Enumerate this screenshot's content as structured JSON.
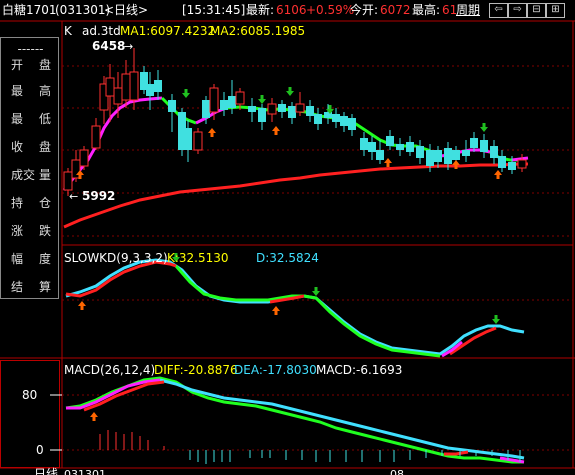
{
  "title_bar": {
    "instrument": "白糖1701",
    "code": "(031301)",
    "period": "<日线>",
    "time": "[15:31:45]",
    "latest_label": "最新:",
    "latest_value": "6106",
    "change_pct": "+0.59%",
    "open_label": "今开:",
    "open_value": "6072",
    "high_label": "最高:",
    "high_value": "61",
    "period_button": "周期",
    "nav_icons": [
      "arrow-left-icon",
      "arrow-right-icon",
      "zoom-out-icon",
      "zoom-in-icon"
    ],
    "nav_glyphs": [
      "⇦",
      "⇨",
      "⊟",
      "⊞"
    ]
  },
  "side_panel": {
    "dash": "------",
    "items": [
      {
        "a": "开",
        "b": "盘"
      },
      {
        "a": "最",
        "b": "高"
      },
      {
        "a": "最",
        "b": "低"
      },
      {
        "a": "收",
        "b": "盘"
      },
      {
        "a": "成交",
        "b": "量"
      },
      {
        "a": "持",
        "b": "仓"
      },
      {
        "a": "涨",
        "b": "跌"
      },
      {
        "a": "幅",
        "b": "度"
      },
      {
        "a": "结",
        "b": "算"
      }
    ]
  },
  "main_chart": {
    "legend_k": "K",
    "legend_name": "ad.3td",
    "ma1_label": "MA1:6097.4232",
    "ma2_label": "MA2:6085.1985",
    "high_marker": "6458",
    "low_marker": "5992"
  },
  "kd_chart": {
    "title": "SLOWKD(9,3,3,2)",
    "k_label": "K:32.5130",
    "d_label": "D:32.5824"
  },
  "macd_chart": {
    "title": "MACD(26,12,4)",
    "diff_label": "DIFF:-20.8876",
    "dea_label": "DEA:-17.8030",
    "macd_label": "MACD:-6.1693",
    "axis_80": "80",
    "axis_0": "0"
  },
  "bottom_bar": {
    "text1": "日线",
    "text2": "031301",
    "text3": "08"
  },
  "colors": {
    "up": "#ff3030",
    "down": "#40e0e0",
    "ma_magenta": "#ff20ff",
    "ma_green": "#20ff20",
    "ma_red": "#ff2020",
    "kd_k": "#40e0ff",
    "kd_d_up": "#ff2020",
    "arrow_up": "#ff6600",
    "arrow_down": "#20c020",
    "yellow": "#ffff00",
    "frame": "#b00000"
  }
}
